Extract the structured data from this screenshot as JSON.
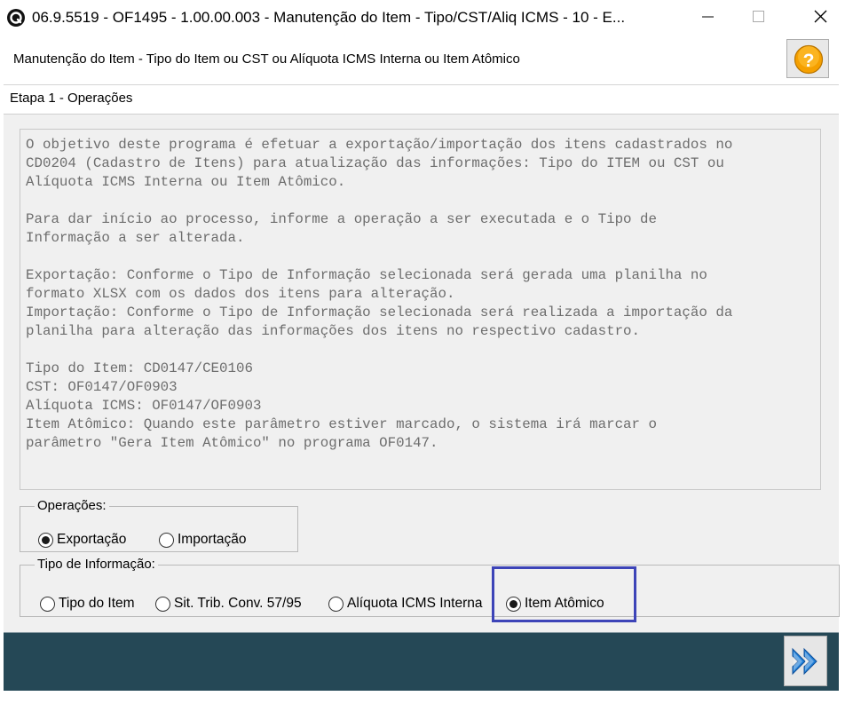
{
  "window": {
    "title": "06.9.5519 - OF1495 - 1.00.00.003 - Manutenção do Item - Tipo/CST/Aliq ICMS - 10 - E...",
    "icon": "app-logo-icon"
  },
  "header": {
    "title": "Manutenção do Item - Tipo do Item ou CST ou Alíquota ICMS Interna ou Item Atômico",
    "help_icon": "help-question-icon"
  },
  "step": {
    "label": "Etapa 1 - Operações"
  },
  "description": {
    "text": "O objetivo deste programa é efetuar a exportação/importação dos itens cadastrados no\nCD0204 (Cadastro de Itens) para atualização das informações: Tipo do ITEM ou CST ou\nAlíquota ICMS Interna ou Item Atômico.\n\nPara dar início ao processo, informe a operação a ser executada e o Tipo de\nInformação a ser alterada.\n\nExportação: Conforme o Tipo de Informação selecionada será gerada uma planilha no\nformato XLSX com os dados dos itens para alteração.\nImportação: Conforme o Tipo de Informação selecionada será realizada a importação da\nplanilha para alteração das informações dos itens no respectivo cadastro.\n\nTipo do Item: CD0147/CE0106\nCST: OF0147/OF0903\nAlíquota ICMS: OF0147/OF0903\nItem Atômico: Quando este parâmetro estiver marcado, o sistema irá marcar o\nparâmetro \"Gera Item Atômico\" no programa OF0147."
  },
  "operacoes": {
    "legend": "Operações:",
    "options": [
      {
        "label": "Exportação",
        "selected": true
      },
      {
        "label": "Importação",
        "selected": false
      }
    ]
  },
  "tipo_informacao": {
    "legend": "Tipo de Informação:",
    "options": [
      {
        "label": "Tipo do Item",
        "selected": false
      },
      {
        "label": "Sit. Trib. Conv. 57/95",
        "selected": false
      },
      {
        "label": "Alíquota ICMS Interna",
        "selected": false
      },
      {
        "label": "Item Atômico",
        "selected": true
      }
    ]
  },
  "footer": {
    "next_icon": "fast-forward-icon"
  },
  "colors": {
    "footer_bg": "#254856",
    "highlight": "#3d44b8",
    "next_arrow": "#1f7fd8",
    "help_bg": "#f5a000"
  }
}
